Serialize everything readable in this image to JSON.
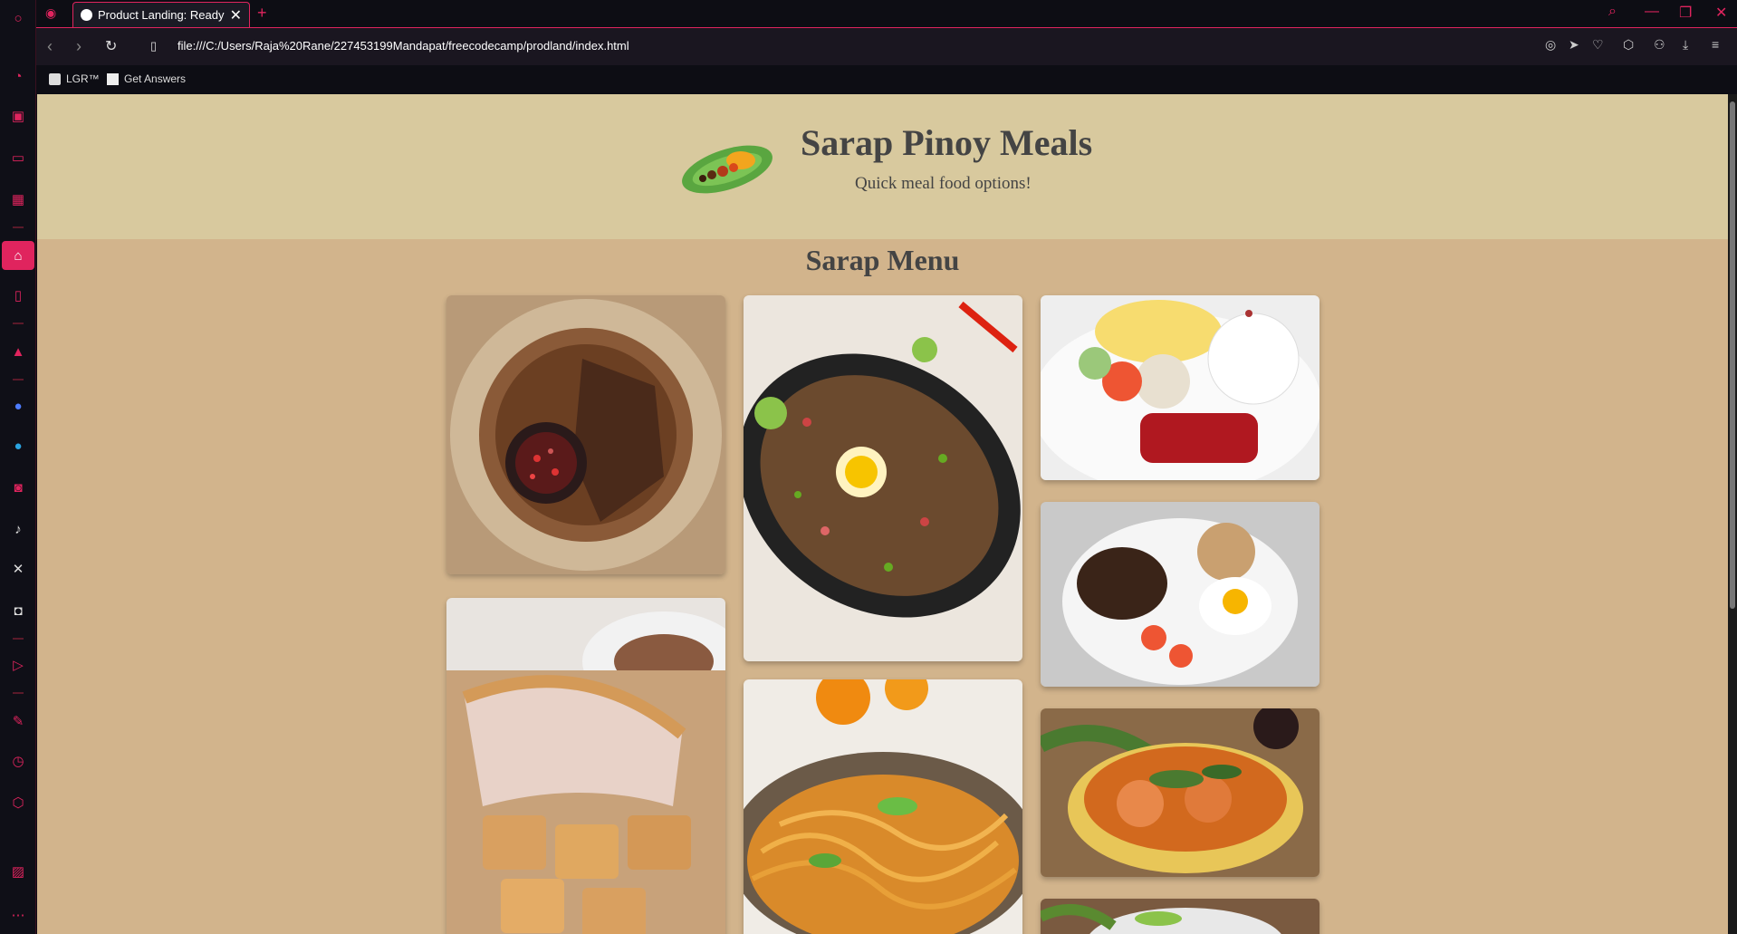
{
  "browser": {
    "tab_title": "Product Landing: Ready to",
    "url": "file:///C:/Users/Raja%20Rane/227453199Mandapat/freecodecamp/prodland/index.html",
    "bookmarks": [
      "LGR™",
      "Get Answers"
    ],
    "accent": "#e0245e"
  },
  "page": {
    "brand": "Sarap Pinoy Meals",
    "tagline": "Quick meal food options!",
    "menu_title": "Sarap Menu"
  }
}
